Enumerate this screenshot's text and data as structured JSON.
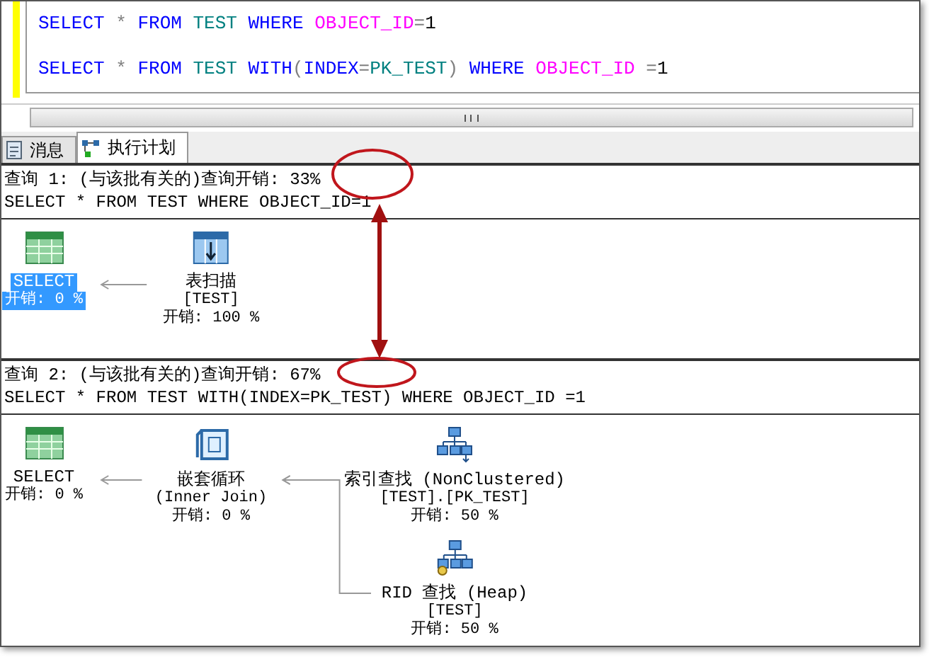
{
  "editor": {
    "lines": [
      {
        "tokens": [
          {
            "text": "SELECT",
            "kind": "keyword"
          },
          {
            "text": " *",
            "kind": "punct"
          },
          {
            "text": " FROM",
            "kind": "keyword"
          },
          {
            "text": " TEST",
            "kind": "object"
          },
          {
            "text": " WHERE",
            "kind": "keyword"
          },
          {
            "text": " OBJECT_ID",
            "kind": "column"
          },
          {
            "text": "=",
            "kind": "punct"
          },
          {
            "text": "1",
            "kind": "literal"
          }
        ]
      },
      {
        "tokens": [
          {
            "text": "SELECT",
            "kind": "keyword"
          },
          {
            "text": " *",
            "kind": "punct"
          },
          {
            "text": " FROM",
            "kind": "keyword"
          },
          {
            "text": " TEST",
            "kind": "object"
          },
          {
            "text": " WITH",
            "kind": "keyword"
          },
          {
            "text": "(",
            "kind": "punct"
          },
          {
            "text": "INDEX",
            "kind": "keyword"
          },
          {
            "text": "=",
            "kind": "punct"
          },
          {
            "text": "PK_TEST",
            "kind": "object"
          },
          {
            "text": ")",
            "kind": "punct"
          },
          {
            "text": " WHERE",
            "kind": "keyword"
          },
          {
            "text": " OBJECT_ID",
            "kind": "column"
          },
          {
            "text": " =",
            "kind": "punct"
          },
          {
            "text": "1",
            "kind": "literal"
          }
        ]
      }
    ]
  },
  "tabs": [
    {
      "label": "消息",
      "kind": "messages",
      "selected": false
    },
    {
      "label": "执行计划",
      "kind": "plan",
      "selected": true
    }
  ],
  "plans": [
    {
      "header": "查询 1: (与该批有关的)查询开销: 33%",
      "sql": "SELECT * FROM TEST WHERE OBJECT_ID=1",
      "root": {
        "kind": "select",
        "selected": true,
        "lines": [
          "SELECT",
          "开销: 0 %"
        ],
        "children": [
          {
            "kind": "table_scan",
            "selected": false,
            "lines": [
              "表扫描",
              "[TEST]",
              "开销: 100 %"
            ]
          }
        ]
      }
    },
    {
      "header": "查询 2: (与该批有关的)查询开销: 67%",
      "sql": "SELECT * FROM TEST WITH(INDEX=PK_TEST) WHERE OBJECT_ID =1",
      "root": {
        "kind": "select",
        "selected": false,
        "lines": [
          "SELECT",
          "开销: 0 %"
        ],
        "children": [
          {
            "kind": "nested_loops",
            "selected": false,
            "lines": [
              "嵌套循环",
              "(Inner Join)",
              "开销: 0 %"
            ],
            "children": [
              {
                "kind": "index_seek",
                "selected": false,
                "lines": [
                  "索引查找 (NonClustered)",
                  "[TEST].[PK_TEST]",
                  "开销: 50 %"
                ]
              },
              {
                "kind": "rid_lookup",
                "selected": false,
                "lines": [
                  "RID 查找 (Heap)",
                  "[TEST]",
                  "开销: 50 %"
                ]
              }
            ]
          }
        ]
      }
    }
  ]
}
